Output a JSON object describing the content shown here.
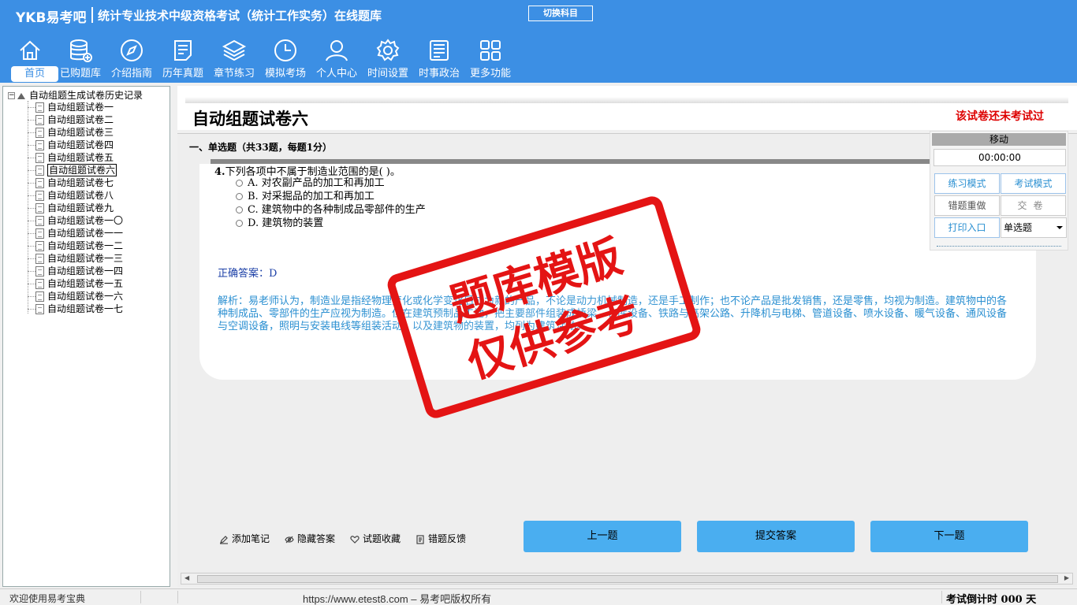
{
  "header": {
    "logo": "YKB易考吧",
    "title": "统计专业技术中级资格考试（统计工作实务）在线题库",
    "switch_subject": "切换科目"
  },
  "nav": [
    {
      "label": "首页",
      "icon": "home-icon"
    },
    {
      "label": "已购题库",
      "icon": "database-icon"
    },
    {
      "label": "介绍指南",
      "icon": "compass-icon"
    },
    {
      "label": "历年真题",
      "icon": "document-list-icon"
    },
    {
      "label": "章节练习",
      "icon": "layers-icon"
    },
    {
      "label": "模拟考场",
      "icon": "clock-icon"
    },
    {
      "label": "个人中心",
      "icon": "user-icon"
    },
    {
      "label": "时间设置",
      "icon": "gear-icon"
    },
    {
      "label": "时事政治",
      "icon": "newspaper-icon"
    },
    {
      "label": "更多功能",
      "icon": "grid-icon"
    }
  ],
  "tree": {
    "root": "自动组题生成试卷历史记录",
    "items": [
      "自动组题试卷一",
      "自动组题试卷二",
      "自动组题试卷三",
      "自动组题试卷四",
      "自动组题试卷五",
      "自动组题试卷六",
      "自动组题试卷七",
      "自动组题试卷八",
      "自动组题试卷九",
      "自动组题试卷一〇",
      "自动组题试卷一一",
      "自动组题试卷一二",
      "自动组题试卷一三",
      "自动组题试卷一四",
      "自动组题试卷一五",
      "自动组题试卷一六",
      "自动组题试卷一七"
    ],
    "selected": "自动组题试卷六"
  },
  "paper": {
    "title": "自动组题试卷六",
    "status": "该试卷还未考试过"
  },
  "section": {
    "title": "一、单选题（共33题，每题1分）"
  },
  "question": {
    "number": "4.",
    "text": "下列各项中不属于制造业范围的是(    )。",
    "options": [
      "A. 对农副产品的加工和再加工",
      "B. 对采掘品的加工和再加工",
      "C. 建筑物中的各种制成品零部件的生产",
      "D. 建筑物的装置"
    ],
    "answer": "正确答案：D",
    "explanation": "解析：易老师认为，制造业是指经物理变化或化学变化后成为新的产品，不论是动力机械制造，还是手工制作；也不论产品是批发销售，还是零售，均视为制造。建筑物中的各种制成品、零部件的生产应视为制造。但在建筑预制品工地，把主要部件组装成桥梁、仓库设备、铁路与高架公路、升降机与电梯、管道设备、喷水设备、暖气设备、通风设备与空调设备，照明与安装电线等组装活动，以及建筑物的装置，均列为建筑活动。"
  },
  "watermark": {
    "line1": "题库模版",
    "line2": "仅供参考"
  },
  "toolbar": {
    "add_note": "添加笔记",
    "hide_answer": "隐藏答案",
    "favorite": "试题收藏",
    "feedback": "错题反馈",
    "prev": "上一题",
    "submit": "提交答案",
    "next": "下一题"
  },
  "side_panel": {
    "move": "移动",
    "timer": "00:00:00",
    "practice_mode": "练习模式",
    "exam_mode": "考试模式",
    "redo_wrong": "错题重做",
    "hand_in": "交卷",
    "print": "打印入口",
    "question_type": "单选题"
  },
  "status_bar": {
    "welcome": "欢迎使用易考宝典",
    "copyright": "https://www.etest8.com – 易考吧版权所有",
    "countdown": "考试倒计时 000 天"
  },
  "colors": {
    "header_bg": "#3c8fe4",
    "button_blue": "#4aaef0",
    "status_red": "#dd0000",
    "answer_blue": "#1a3ea6",
    "explanation_blue": "#2a8fd1",
    "watermark_red": "#e41414"
  }
}
